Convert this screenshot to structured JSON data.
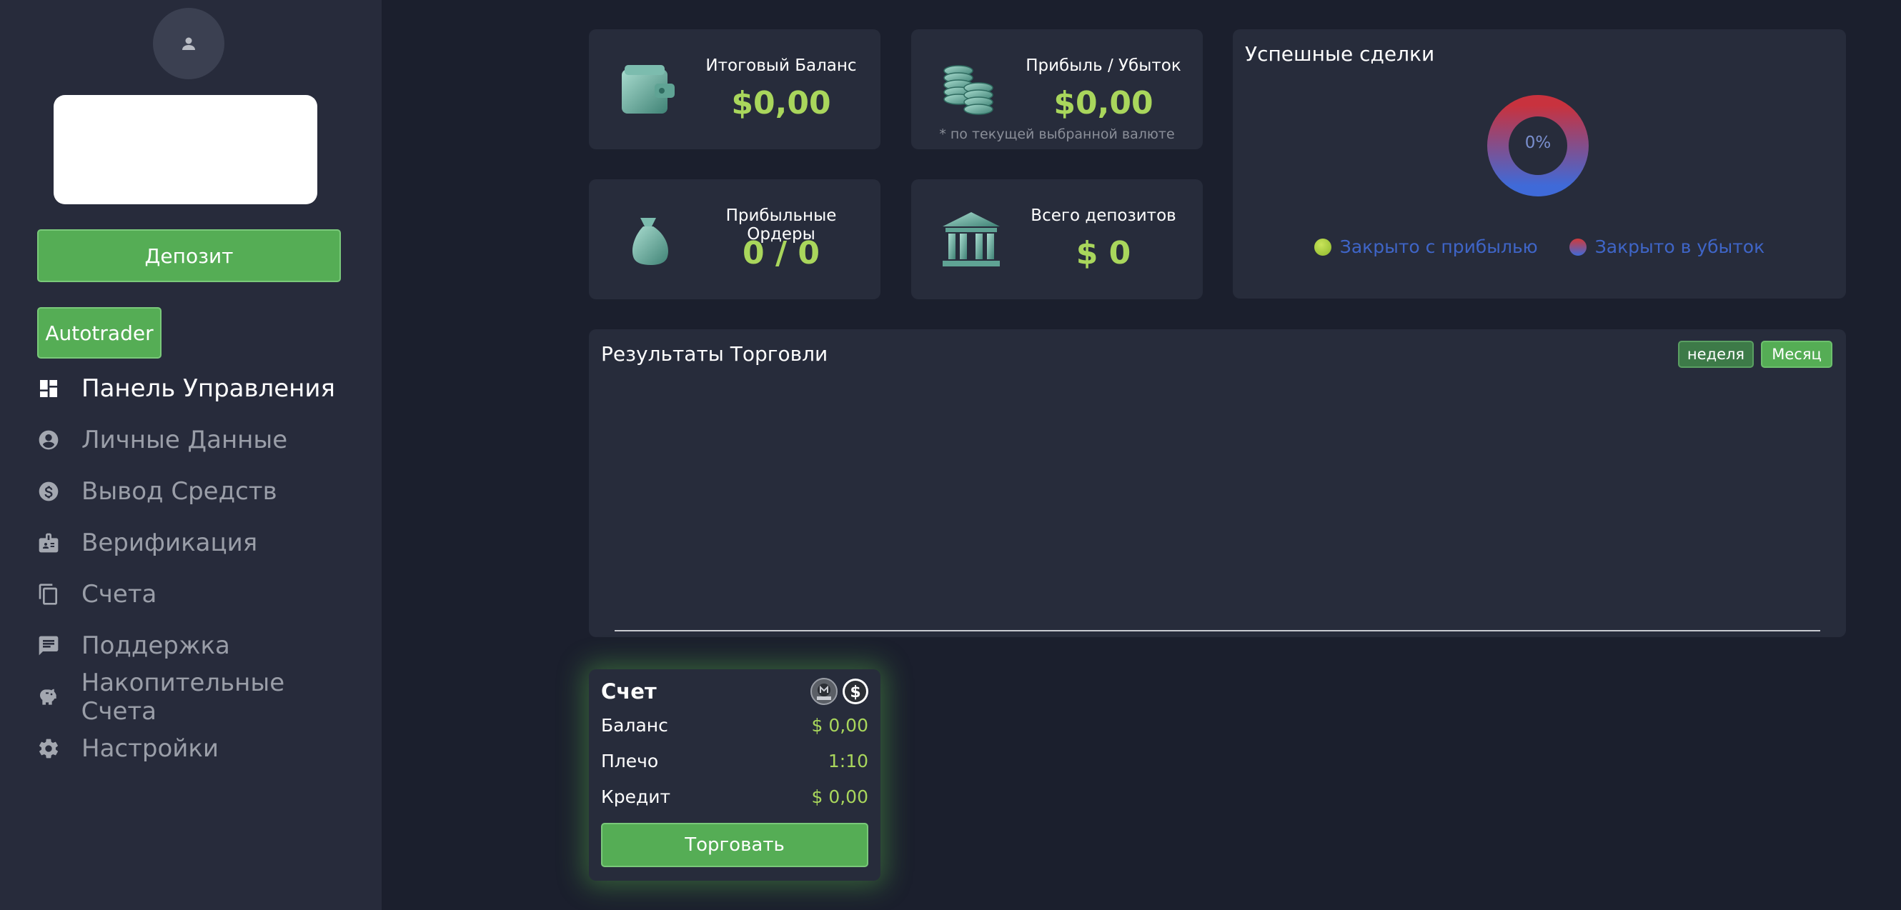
{
  "sidebar": {
    "deposit_label": "Депозит",
    "autotrader_label": "Autotrader",
    "nav": [
      {
        "label": "Панель Управления",
        "icon": "dashboard-icon"
      },
      {
        "label": "Личные Данные",
        "icon": "user-circle-icon"
      },
      {
        "label": "Вывод Средств",
        "icon": "dollar-circle-icon"
      },
      {
        "label": "Верификация",
        "icon": "id-badge-icon"
      },
      {
        "label": "Счета",
        "icon": "copy-icon"
      },
      {
        "label": "Поддержка",
        "icon": "chat-icon"
      },
      {
        "label": "Накопительные Счета",
        "icon": "piggy-bank-icon"
      },
      {
        "label": "Настройки",
        "icon": "gear-icon"
      }
    ]
  },
  "stats": {
    "total_balance": {
      "label": "Итоговый Баланс",
      "value": "$0,00"
    },
    "profit_loss": {
      "label": "Прибыль / Убыток",
      "value": "$0,00",
      "note": "* по текущей выбранной валюте"
    },
    "profit_orders": {
      "label": "Прибыльные Ордеры",
      "value": "0 / 0"
    },
    "total_deposits": {
      "label": "Всего депозитов",
      "value": "$ 0"
    }
  },
  "successful_trades": {
    "title": "Успешные сделки",
    "percent": "0%",
    "legend_profit": "Закрыто с прибылью",
    "legend_loss": "Закрыто в убыток"
  },
  "trading_results": {
    "title": "Результаты Торговли",
    "week_label": "неделя",
    "month_label": "Месяц"
  },
  "account": {
    "title": "Счет",
    "balance_label": "Баланс",
    "balance_value": "$ 0,00",
    "leverage_label": "Плечо",
    "leverage_value": "1:10",
    "credit_label": "Кредит",
    "credit_value": "$ 0,00",
    "trade_label": "Торговать"
  },
  "colors": {
    "accent_green": "#55ad55",
    "value_green": "#a9d65c",
    "legend_blue": "#3f65c7"
  }
}
